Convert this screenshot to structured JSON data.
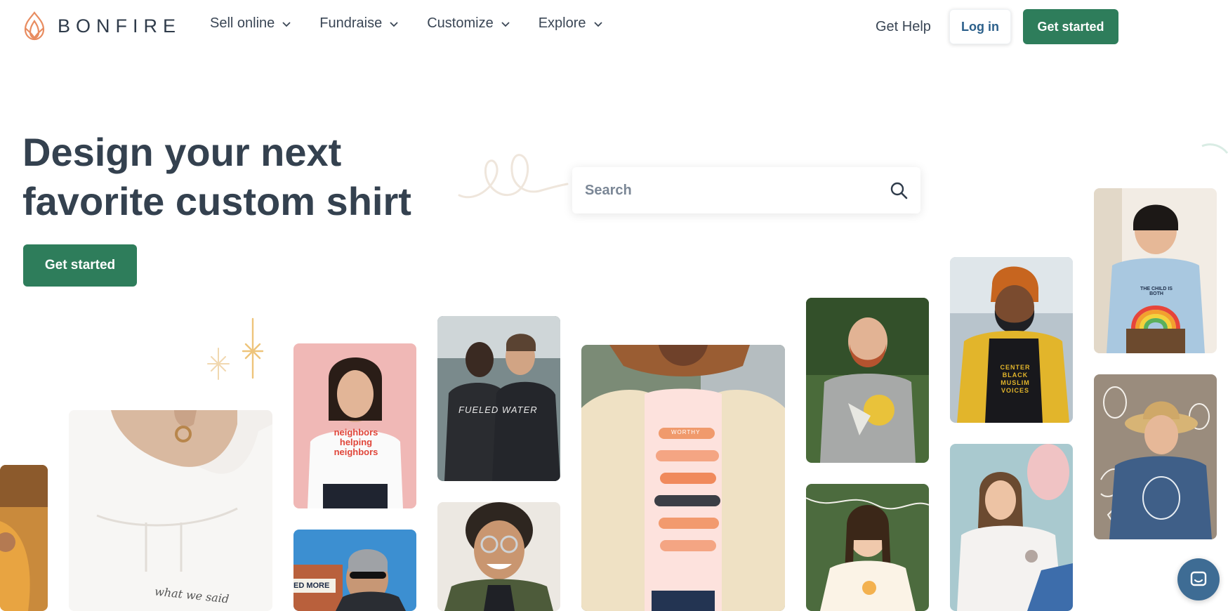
{
  "brand": {
    "name": "BONFIRE",
    "accent": "#2e7d5b",
    "logo_color": "#e88c60"
  },
  "nav": {
    "items": [
      {
        "label": "Sell online"
      },
      {
        "label": "Fundraise"
      },
      {
        "label": "Customize"
      },
      {
        "label": "Explore"
      }
    ],
    "get_help": "Get Help",
    "login": "Log in",
    "get_started": "Get started"
  },
  "hero": {
    "title_line1": "Design your next",
    "title_line2": "favorite custom shirt",
    "cta": "Get started"
  },
  "search": {
    "placeholder": "Search",
    "icon": "search-icon"
  },
  "photos": [
    {
      "name": "photo-orange-shirt",
      "shirt_text": ""
    },
    {
      "name": "photo-white-hoodie",
      "shirt_text": "what we said"
    },
    {
      "name": "photo-neighbors-shirt",
      "shirt_text": "neighbors helping neighbors"
    },
    {
      "name": "photo-man-sunglasses",
      "shirt_text": "ED MORE"
    },
    {
      "name": "photo-fueled-water",
      "shirt_text": "FUELED WATER"
    },
    {
      "name": "photo-woman-glasses",
      "shirt_text": ""
    },
    {
      "name": "photo-worthy-shirt",
      "shirt_text": "WORTHY"
    },
    {
      "name": "photo-bearded-man",
      "shirt_text": ""
    },
    {
      "name": "photo-woman-braids",
      "shirt_text": ""
    },
    {
      "name": "photo-center-black-muslim",
      "shirt_text": "CENTER BLACK MUSLIM VOICES"
    },
    {
      "name": "photo-woman-sweatshirt",
      "shirt_text": ""
    },
    {
      "name": "photo-kid-rainbow",
      "shirt_text": "THE CHILD IS BOTH"
    },
    {
      "name": "photo-man-hat-sweater",
      "shirt_text": ""
    }
  ],
  "chat": {
    "icon": "chat-icon"
  }
}
